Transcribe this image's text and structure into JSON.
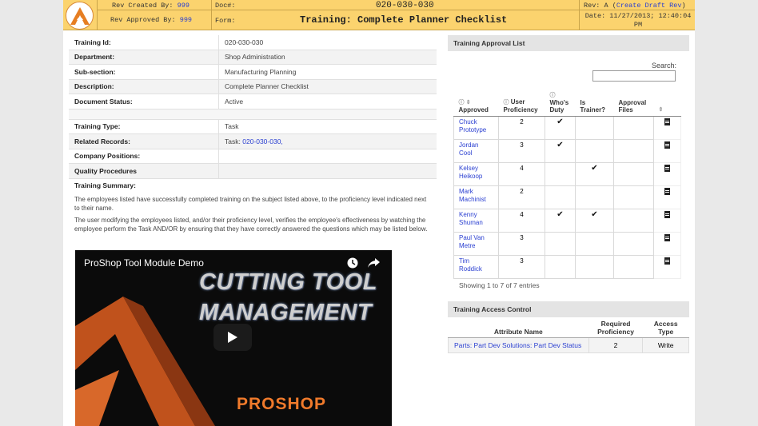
{
  "header": {
    "rev_created_by_label": "Rev Created By:",
    "rev_created_by_value": "999",
    "rev_approved_by_label": "Rev Approved By:",
    "rev_approved_by_value": "999",
    "doc_label": "Doc#:",
    "doc_number": "020-030-030",
    "form_label": "Form:",
    "title": "Training: Complete Planner Checklist",
    "rev_label": "Rev: A (",
    "create_draft_rev": "Create Draft Rev",
    "rev_close": ")",
    "date": "Date: 11/27/2013; 12:40:04 PM"
  },
  "info": {
    "rows": [
      {
        "label": "Training Id:",
        "value": "020-030-030"
      },
      {
        "label": "Department:",
        "value": "Shop Administration"
      },
      {
        "label": "Sub-section:",
        "value": "Manufacturing Planning"
      },
      {
        "label": "Description:",
        "value": "Complete Planner Checklist"
      },
      {
        "label": "Document Status:",
        "value": "Active"
      }
    ],
    "rows2": [
      {
        "label": "Training Type:",
        "value": "Task"
      },
      {
        "label": "Related Records:",
        "value_prefix": "Task: ",
        "value_link": "020-030-030,"
      },
      {
        "label": "Company Positions:",
        "value": ""
      },
      {
        "label": "Quality Procedures",
        "value": ""
      },
      {
        "label": "Training Summary:",
        "value": ""
      }
    ],
    "summary_p1": "The employees listed have successfully completed training on the subject listed above, to the proficiency level indicated next to their name.",
    "summary_p2": "The user modifying the employees listed, and/or their proficiency level, verifies the employee's effectiveness by watching the employee perform the Task AND/OR by ensuring that they have correctly answered the questions which may be listed below."
  },
  "video": {
    "title": "ProShop Tool Module Demo",
    "big_line1": "CUTTING TOOL",
    "big_line2": "MANAGEMENT",
    "brand": "PROSHOP"
  },
  "approval": {
    "heading": "Training Approval List",
    "search_label": "Search:",
    "columns": [
      "Approved",
      "User Proficiency",
      "Who's Duty",
      "Is Trainer?",
      "Approval Files",
      ""
    ],
    "rows": [
      {
        "name": "Chuck Prototype",
        "prof": "2",
        "duty": "✔",
        "trainer": ""
      },
      {
        "name": "Jordan Cool",
        "prof": "3",
        "duty": "✔",
        "trainer": ""
      },
      {
        "name": "Kelsey Heikoop",
        "prof": "4",
        "duty": "",
        "trainer": "✔"
      },
      {
        "name": "Mark Machinist",
        "prof": "2",
        "duty": "",
        "trainer": ""
      },
      {
        "name": "Kenny Shuman",
        "prof": "4",
        "duty": "✔",
        "trainer": "✔"
      },
      {
        "name": "Paul Van Metre",
        "prof": "3",
        "duty": "",
        "trainer": ""
      },
      {
        "name": "Tim Roddick",
        "prof": "3",
        "duty": "",
        "trainer": ""
      }
    ],
    "showing": "Showing 1 to 7 of 7 entries"
  },
  "access": {
    "heading": "Training Access Control",
    "col_attr": "Attribute Name",
    "col_req": "Required Proficiency",
    "col_type": "Access Type",
    "row_attr": "Parts: Part Dev Solutions: Part Dev Status",
    "row_req": "2",
    "row_type": "Write"
  },
  "colors": {
    "header_bg": "#fbd36e",
    "link": "#2a3fd1",
    "brand_orange": "#f07a2b"
  },
  "icons": [
    "proshop-logo-icon",
    "clock-icon",
    "share-icon",
    "play-icon",
    "document-icon",
    "sort-icon",
    "info-icon"
  ]
}
